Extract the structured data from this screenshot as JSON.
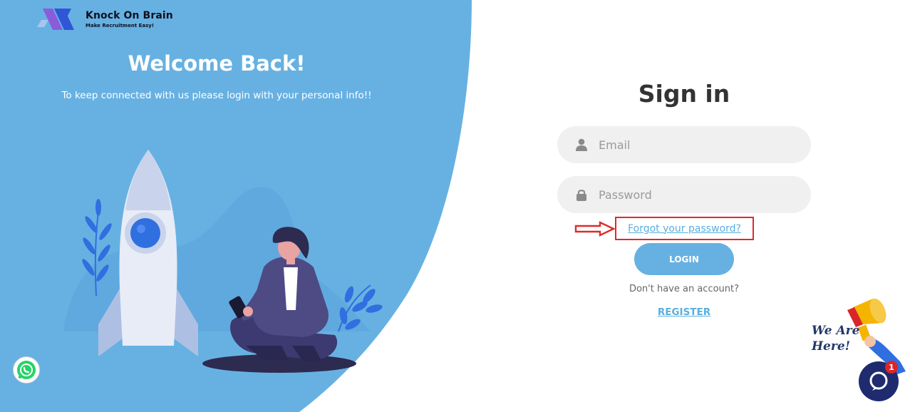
{
  "brand": {
    "name": "Knock On Brain",
    "tagline": "Make Recruitment Easy!",
    "colors": {
      "primary": "#67b1e2",
      "logo_purple": "#8a5cdc",
      "logo_blue": "#2f56d6"
    }
  },
  "hero": {
    "title": "Welcome Back!",
    "subtitle": "To keep connected with us please login with your personal info!!"
  },
  "signin": {
    "title": "Sign in",
    "email_placeholder": "Email",
    "password_placeholder": "Password",
    "forgot_label": "Forgot your password?",
    "login_label": "LOGIN",
    "no_account_text": "Don't have an account?",
    "register_label": "REGISTER"
  },
  "widgets": {
    "we_are_here_line1": "We Are",
    "we_are_here_line2": "Here!",
    "chat_badge_count": "1"
  },
  "icons": [
    "user-icon",
    "lock-icon",
    "whatsapp-icon",
    "chat-icon",
    "megaphone-icon",
    "arrow-right-icon"
  ],
  "colors": {
    "accent": "#67b1e2",
    "link": "#5aaedf",
    "highlight_red": "#e02a2a",
    "field_bg": "#f0f0f0",
    "chat_bg": "#1f2b6e",
    "badge_red": "#d9262a"
  }
}
